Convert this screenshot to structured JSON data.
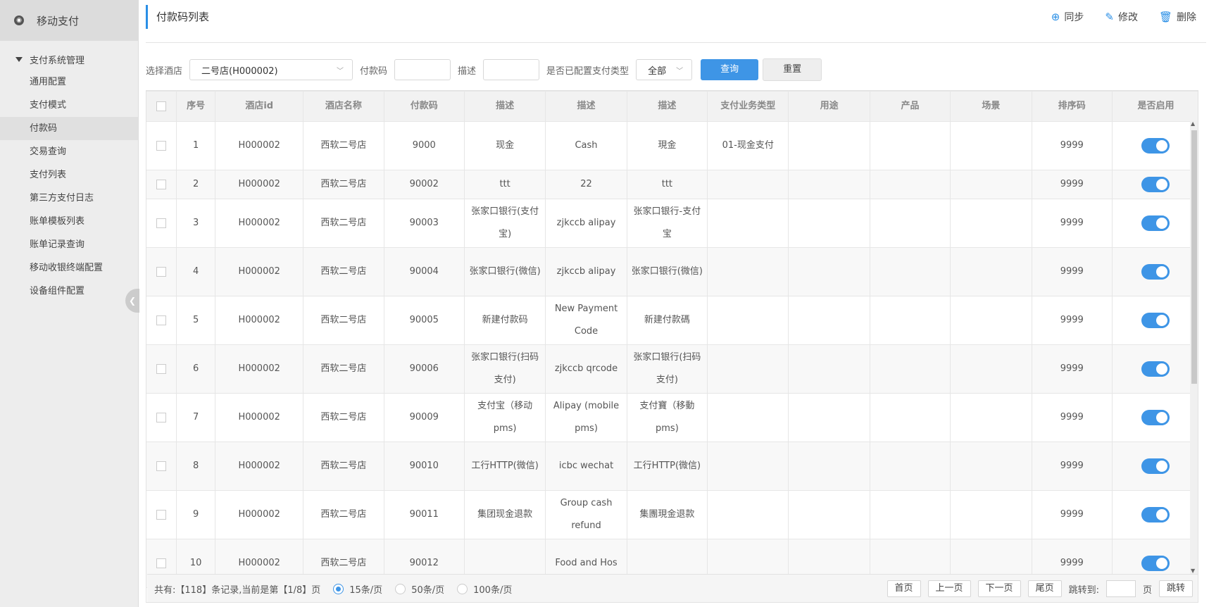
{
  "sidebar": {
    "app_title": "移动支付",
    "group": "支付系统管理",
    "items": [
      "通用配置",
      "支付模式",
      "付款码",
      "交易查询",
      "支付列表",
      "第三方支付日志",
      "账单模板列表",
      "账单记录查询",
      "移动收银终端配置",
      "设备组件配置"
    ],
    "active_index": 2
  },
  "header": {
    "title": "付款码列表",
    "sync_label": "同步",
    "edit_label": "修改",
    "delete_label": "删除"
  },
  "filter": {
    "hotel_label": "选择酒店",
    "hotel_value": "二号店(H000002)",
    "code_label": "付款码",
    "desc_label": "描述",
    "configured_label": "是否已配置支付类型",
    "configured_value": "全部",
    "query_label": "查询",
    "reset_label": "重置"
  },
  "table": {
    "columns": [
      "",
      "序号",
      "酒店id",
      "酒店名称",
      "付款码",
      "描述",
      "描述",
      "描述",
      "支付业务类型",
      "用途",
      "产品",
      "场景",
      "排序码",
      "是否启用"
    ],
    "rows": [
      [
        "1",
        "H000002",
        "西软二号店",
        "9000",
        "现金",
        "Cash",
        "現金",
        "01-现金支付",
        "",
        "",
        "",
        "9999"
      ],
      [
        "2",
        "H000002",
        "西软二号店",
        "90002",
        "ttt",
        "22",
        "ttt",
        "",
        "",
        "",
        "",
        "9999"
      ],
      [
        "3",
        "H000002",
        "西软二号店",
        "90003",
        "张家口银行(支付宝)",
        "zjkccb alipay",
        "张家口银行-支付宝",
        "",
        "",
        "",
        "",
        "9999"
      ],
      [
        "4",
        "H000002",
        "西软二号店",
        "90004",
        "张家口银行(微信)",
        "zjkccb alipay",
        "张家口银行(微信)",
        "",
        "",
        "",
        "",
        "9999"
      ],
      [
        "5",
        "H000002",
        "西软二号店",
        "90005",
        "新建付款码",
        "New Payment Code",
        "新建付款碼",
        "",
        "",
        "",
        "",
        "9999"
      ],
      [
        "6",
        "H000002",
        "西软二号店",
        "90006",
        "张家口银行(扫码支付)",
        "zjkccb qrcode",
        "张家口银行(扫码支付)",
        "",
        "",
        "",
        "",
        "9999"
      ],
      [
        "7",
        "H000002",
        "西软二号店",
        "90009",
        "支付宝（移动pms)",
        "Alipay (mobile pms)",
        "支付寶（移動pms)",
        "",
        "",
        "",
        "",
        "9999"
      ],
      [
        "8",
        "H000002",
        "西软二号店",
        "90010",
        "工行HTTP(微信)",
        "icbc wechat",
        "工行HTTP(微信)",
        "",
        "",
        "",
        "",
        "9999"
      ],
      [
        "9",
        "H000002",
        "西软二号店",
        "90011",
        "集团现金退款",
        "Group cash refund",
        "集團現金退款",
        "",
        "",
        "",
        "",
        "9999"
      ],
      [
        "10",
        "H000002",
        "西软二号店",
        "90012",
        "",
        "Food and Hos",
        "",
        "",
        "",
        "",
        "",
        "9999"
      ]
    ]
  },
  "pagination": {
    "summary": "共有:【118】条记录,当前是第【1/8】页",
    "size_15": "15条/页",
    "size_50": "50条/页",
    "size_100": "100条/页",
    "first": "首页",
    "prev": "上一页",
    "next": "下一页",
    "last": "尾页",
    "jump_label": "跳转到:",
    "page_unit": "页",
    "jump_button": "跳转"
  },
  "colors": {
    "accent": "#3e95e6"
  }
}
